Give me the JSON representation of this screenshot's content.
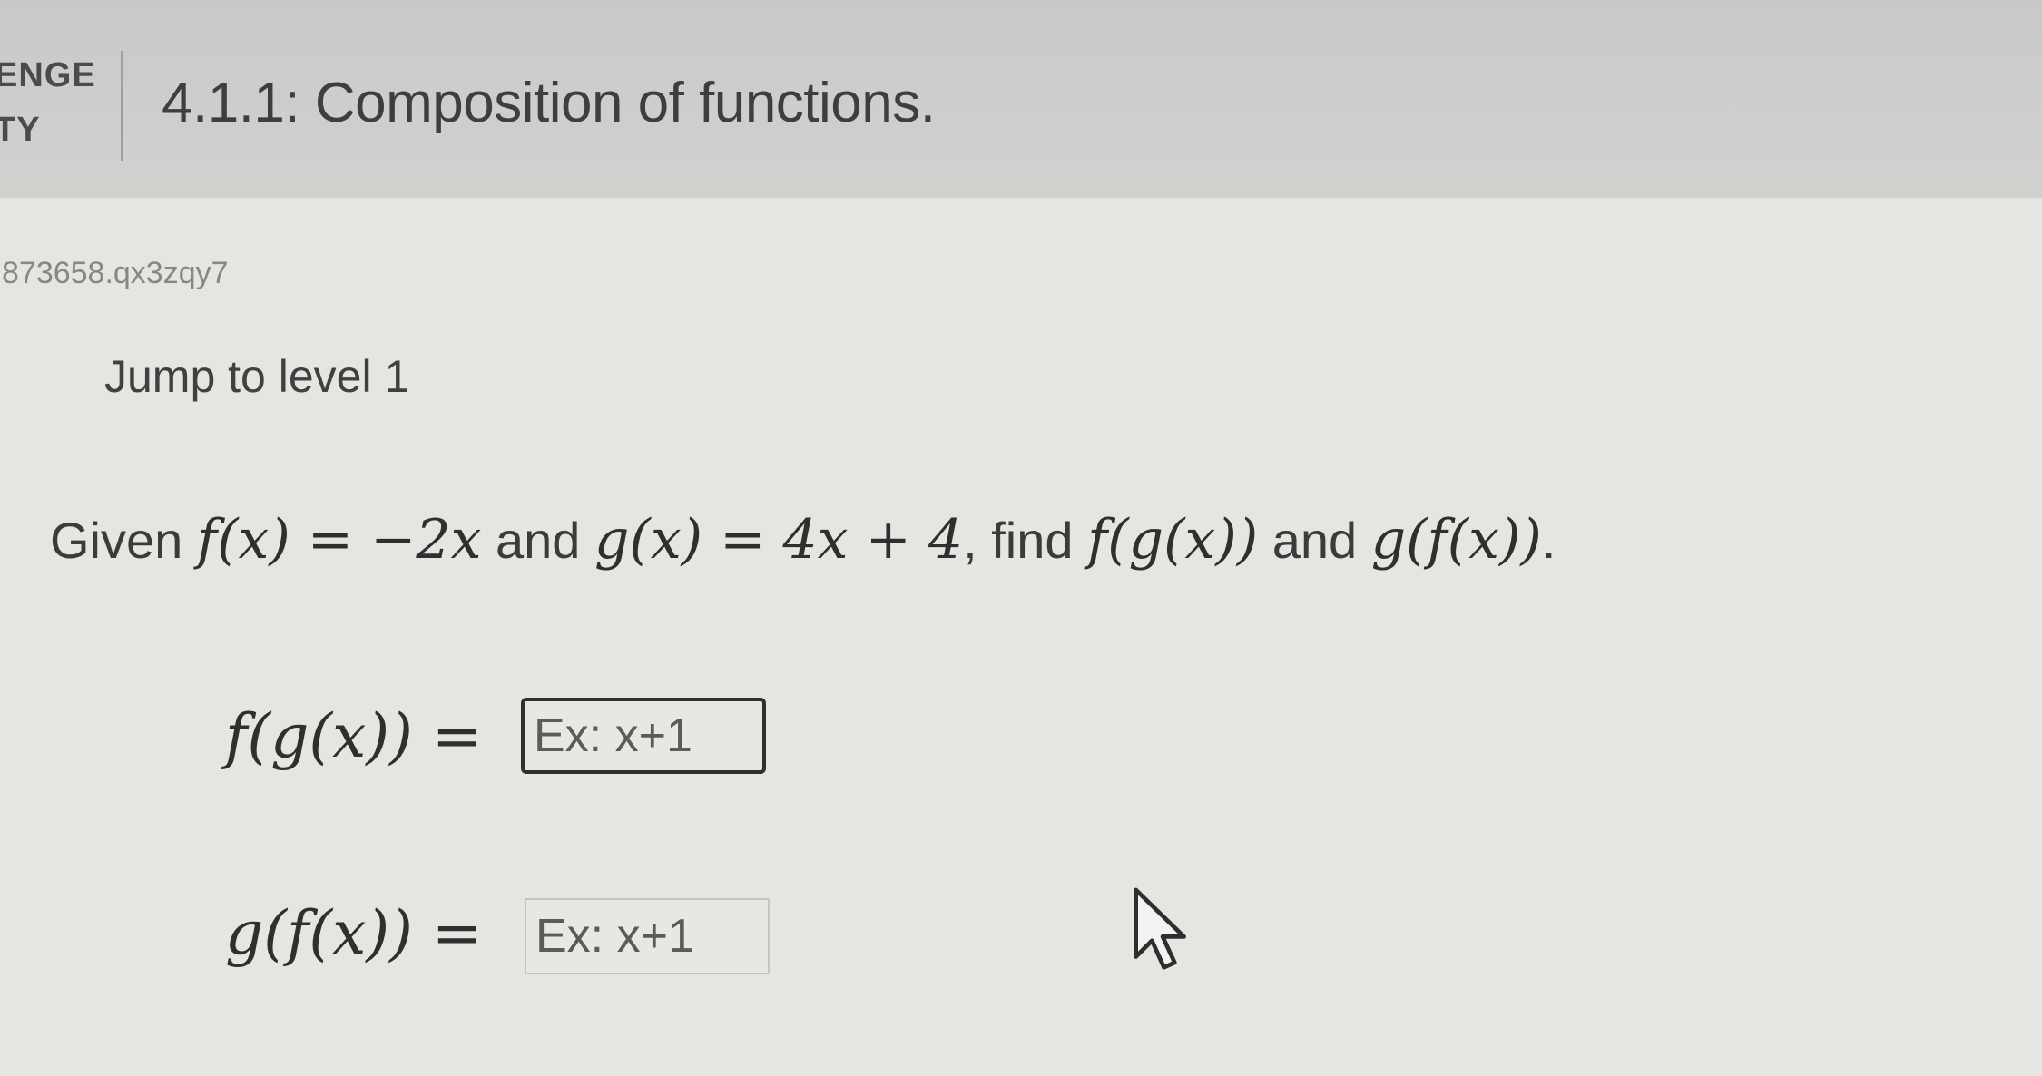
{
  "header": {
    "badge_line1": "ENGE",
    "badge_line2": "TY",
    "title": "4.1.1: Composition of functions."
  },
  "activity_id": "873658.qx3zqy7",
  "jump_label": "Jump to level 1",
  "problem": {
    "given": "Given ",
    "f_def": "f(x) = −2x",
    "and_1": " and ",
    "g_def": "g(x) = 4x + 4",
    "find": ", find ",
    "fg": "f(g(x))",
    "and_2": " and ",
    "gf": "g(f(x))",
    "end": "."
  },
  "answers": [
    {
      "label": "f(g(x)) =",
      "placeholder": "Ex: x+1",
      "value": ""
    },
    {
      "label": "g(f(x)) =",
      "placeholder": "Ex: x+1",
      "value": ""
    }
  ],
  "icons": {
    "cursor": "mouse-pointer-icon"
  },
  "colors": {
    "header_bg": "#c9cac8",
    "page_bg": "#e4e6e2",
    "text": "#3a3c3a"
  }
}
